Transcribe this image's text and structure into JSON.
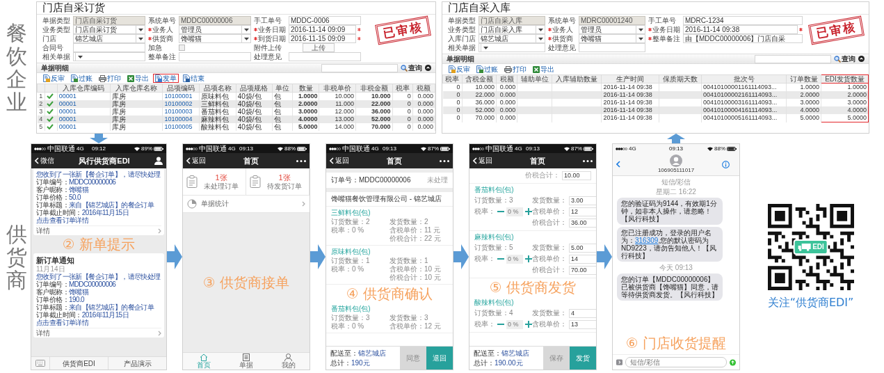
{
  "enterprise": {
    "side_label": "餐饮企业",
    "windows": [
      {
        "title": "门店自采订货",
        "stamp": "已审核",
        "form": [
          [
            {
              "label": "单据类型",
              "kind": "text",
              "value": "门店自采订货",
              "readonly": true
            },
            {
              "label": "系统单号",
              "kind": "text",
              "value": "MDDC00000006",
              "readonly": true
            },
            {
              "label": "手工单号",
              "kind": "text",
              "value": "MDDC-0006",
              "readonly": false
            }
          ],
          [
            {
              "label": "业务类型",
              "kind": "select",
              "value": "门店自采订货"
            },
            {
              "label": "业务人",
              "kind": "select",
              "value": "管理员",
              "required": true
            },
            {
              "label": "业务日期",
              "kind": "text",
              "value": "2016-11-14 09:09",
              "readonly": false,
              "required": true,
              "flagged": true
            }
          ],
          [
            {
              "label": "门店",
              "kind": "select",
              "value": "锦艺城店"
            },
            {
              "label": "供货商",
              "kind": "select",
              "value": "馋嘴猫",
              "required": true
            },
            {
              "label": "到货日期",
              "kind": "text",
              "value": "2016-11-15 09:09",
              "readonly": false,
              "required": true,
              "flagged": true
            }
          ],
          [
            {
              "label": "合同号",
              "kind": "text",
              "readonly": false
            },
            {
              "label": "加急",
              "kind": "checkbox",
              "checked": false
            },
            {
              "label": "附件上传",
              "kind": "button",
              "button": "上传"
            }
          ],
          [
            {
              "label": "相关单据",
              "kind": "select"
            },
            {
              "label": "整单备注",
              "kind": "text",
              "readonly": false
            },
            {
              "label": "处理意见",
              "kind": "text",
              "readonly": false
            }
          ]
        ],
        "section": {
          "title": "单据明细",
          "search_button": "查询"
        },
        "toolbar": [
          {
            "label": "反审",
            "kind": "review",
            "highlighted": false
          },
          {
            "label": "过账",
            "kind": "post",
            "highlighted": false
          },
          {
            "label": "打印",
            "kind": "print",
            "highlighted": false
          },
          {
            "label": "导出",
            "kind": "export",
            "highlighted": false
          },
          {
            "label": "发单",
            "kind": "send",
            "highlighted": true
          },
          {
            "label": "结束",
            "kind": "finish",
            "highlighted": false
          }
        ],
        "table": {
          "columns": [
            {
              "label": "入库仓库编码",
              "kind": "code"
            },
            {
              "label": "入库仓库名称",
              "kind": "text"
            },
            {
              "label": "品项编码",
              "kind": "code"
            },
            {
              "label": "品项名称",
              "kind": "text"
            },
            {
              "label": "品项规格",
              "kind": "text"
            },
            {
              "label": "单位",
              "kind": "text"
            },
            {
              "label": "数量",
              "kind": "number",
              "bold": true
            },
            {
              "label": "非税单价",
              "kind": "number"
            },
            {
              "label": "非税金额",
              "kind": "number",
              "bold": true
            },
            {
              "label": "税率",
              "kind": "number"
            },
            {
              "label": "税额",
              "kind": "number"
            }
          ],
          "rows": [
            {
              "no": "1",
              "approved": true,
              "cells": [
                "00001",
                "库房",
                "10100001",
                "原味料包",
                "40袋/包",
                "包",
                "1.0000",
                "10.000",
                "10.000",
                "0",
                "0.000"
              ]
            },
            {
              "no": "2",
              "approved": true,
              "cells": [
                "00001",
                "库房",
                "10100002",
                "三鲜料包",
                "40袋/包",
                "包",
                "2.0000",
                "11.000",
                "22.000",
                "0",
                "0.000"
              ]
            },
            {
              "no": "3",
              "approved": true,
              "cells": [
                "00001",
                "库房",
                "10100003",
                "番茄料包",
                "40袋/包",
                "包",
                "3.0000",
                "12.000",
                "36.000",
                "0",
                "0.000"
              ]
            },
            {
              "no": "4",
              "approved": true,
              "cells": [
                "00001",
                "库房",
                "10100004",
                "麻辣料包",
                "40袋/包",
                "包",
                "4.0000",
                "13.000",
                "52.000",
                "0",
                "0.000"
              ]
            },
            {
              "no": "5",
              "approved": true,
              "cells": [
                "00001",
                "库房",
                "10100005",
                "酸辣料包",
                "40袋/包",
                "包",
                "5.0000",
                "14.000",
                "70.000",
                "0",
                "0.000"
              ]
            }
          ]
        }
      },
      {
        "title": "门店自采入库",
        "stamp": "已审核",
        "form": [
          [
            {
              "label": "单据类型",
              "kind": "text",
              "value": "门店自采入库",
              "readonly": true
            },
            {
              "label": "系统单号",
              "kind": "text",
              "value": "MDRC00001240",
              "readonly": true
            },
            {
              "label": "手工单号",
              "kind": "text",
              "value": "MDRC-1234",
              "readonly": false
            }
          ],
          [
            {
              "label": "业务类型",
              "kind": "select",
              "value": "门店自采入库"
            },
            {
              "label": "业务人",
              "kind": "select",
              "value": "管理员",
              "required": true
            },
            {
              "label": "业务日期",
              "kind": "text",
              "value": "2016-11-14 09:38",
              "readonly": false,
              "required": true,
              "flagged": true
            }
          ],
          [
            {
              "label": "入库门店",
              "kind": "select",
              "value": "锦艺城店"
            },
            {
              "label": "供货商",
              "kind": "select",
              "value": "馋嘴猫",
              "required": true
            },
            {
              "label": "整单备注",
              "kind": "text",
              "value": "由【MDDC00000006】门店自采",
              "readonly": false,
              "required": true
            }
          ],
          [
            {
              "label": "相关单据",
              "kind": "select"
            },
            {
              "label": "处理意见",
              "kind": "text",
              "readonly": false
            }
          ]
        ],
        "section": {
          "title": "单据明细",
          "search_button": "查询"
        },
        "toolbar": [
          {
            "label": "反审",
            "kind": "review",
            "highlighted": false
          },
          {
            "label": "过账",
            "kind": "post",
            "highlighted": false
          },
          {
            "label": "打印",
            "kind": "print",
            "highlighted": false
          },
          {
            "label": "导出",
            "kind": "export",
            "highlighted": false
          }
        ],
        "table": {
          "columns": [
            {
              "label": "税率",
              "kind": "number",
              "highlighted": false
            },
            {
              "label": "含税金额",
              "kind": "number",
              "highlighted": false
            },
            {
              "label": "税额",
              "kind": "number",
              "highlighted": false
            },
            {
              "label": "辅助单位",
              "kind": "text",
              "highlighted": false
            },
            {
              "label": "入库辅助数量",
              "kind": "text",
              "highlighted": false
            },
            {
              "label": "生产时间",
              "kind": "date",
              "highlighted": false
            },
            {
              "label": "保质期天数",
              "kind": "text",
              "highlighted": false
            },
            {
              "label": "批次号",
              "kind": "date",
              "highlighted": false
            },
            {
              "label": "订单数量",
              "kind": "number",
              "highlighted": false
            },
            {
              "label": "EDI发货数量",
              "kind": "number",
              "highlighted": true
            }
          ],
          "rows": [
            {
              "cells": [
                "0",
                "10.000",
                "0.000",
                null,
                null,
                "2016-11-14 09:38",
                null,
                "00410100001161114093...",
                "1.0000",
                "1.0000"
              ]
            },
            {
              "cells": [
                "0",
                "22.000",
                "0.000",
                null,
                null,
                "2016-11-14 09:38",
                null,
                "00410100002161114093...",
                "2.0000",
                "2.0000"
              ]
            },
            {
              "cells": [
                "0",
                "36.000",
                "0.000",
                null,
                null,
                "2016-11-14 09:38",
                null,
                "00410100003161114093...",
                "3.0000",
                "3.0000"
              ]
            },
            {
              "cells": [
                "0",
                "52.000",
                "0.000",
                null,
                null,
                "2016-11-14 09:38",
                null,
                "00410100004161114093...",
                "4.0000",
                "4.0000"
              ]
            },
            {
              "cells": [
                "0",
                "70.000",
                "0.000",
                null,
                null,
                "2016-11-14 09:38",
                null,
                "00410100005161114093...",
                "5.0000",
                "5.0000"
              ]
            }
          ]
        }
      }
    ]
  },
  "supplier": {
    "side_label": "供货商",
    "phones": [
      {
        "kind": "chat",
        "status": {
          "carrier": "中国联通",
          "network": "4G",
          "time": "09:12",
          "battery": "89%"
        },
        "nav": {
          "back": "微信",
          "title": "风行供货商EDI"
        },
        "caption": "② 新单提示",
        "cards": [
          {
            "lines": [
              {
                "kind": "notice",
                "text": "您收到了一张新【餐企订单】，请尽快处理"
              },
              {
                "kind": "field",
                "label": "订单编号：",
                "value": "MDDC00000006"
              },
              {
                "kind": "field",
                "label": "客户昵称：",
                "value": "馋嘴猫"
              },
              {
                "kind": "field",
                "label": "订单价格：",
                "value": "50.0"
              },
              {
                "kind": "field",
                "label": "订单标题：",
                "value": "来自【锦艺城店】的餐企订单"
              },
              {
                "kind": "field",
                "label": "订单截止时间：",
                "value": "2016年11月15日"
              },
              {
                "kind": "link",
                "text": "点击查看订单详情"
              }
            ],
            "footer": "详情"
          },
          {
            "title": "新订单通知",
            "date": "11月14日",
            "lines": [
              {
                "kind": "notice",
                "text": "您收到了一张新【餐企订单】，请尽快处理"
              },
              {
                "kind": "field",
                "label": "订单编号：",
                "value": "MDDC00000006"
              },
              {
                "kind": "field",
                "label": "客户昵称：",
                "value": "馋嘴猫"
              },
              {
                "kind": "field",
                "label": "订单价格：",
                "value": "190.0"
              },
              {
                "kind": "field",
                "label": "订单标题：",
                "value": "来自【锦艺城店】的餐企订单"
              },
              {
                "kind": "field",
                "label": "订单截止时间：",
                "value": "2016年11月15日"
              },
              {
                "kind": "link",
                "text": "点击查看订单详情"
              }
            ],
            "footer": "详情"
          }
        ],
        "menu": [
          "供货商EDI",
          "产品演示"
        ]
      },
      {
        "kind": "home",
        "status": {
          "carrier": "中国联通",
          "network": "4G",
          "time": "09:13",
          "battery": "88%"
        },
        "nav": {
          "back": "返回",
          "title": "首页"
        },
        "caption": "③ 供货商接单",
        "tiles": [
          {
            "count": "1张",
            "label": "未处理订单"
          },
          {
            "count": "1张",
            "label": "待发货订单"
          }
        ],
        "row": "单据统计",
        "tabs": [
          {
            "label": "首页",
            "selected": true
          },
          {
            "label": "单据",
            "selected": false
          },
          {
            "label": "我的",
            "selected": false
          }
        ]
      },
      {
        "kind": "order",
        "status": {
          "carrier": "中国联通",
          "network": "4G",
          "time": "09:13",
          "battery": "87%"
        },
        "nav": {
          "back": "返回",
          "title": "首页"
        },
        "caption": "④ 供货商确认",
        "order_no": "订单号：MDDC00000006",
        "order_status": "未处理",
        "company": "馋嘴猫餐饮管理有限公司 - 锦艺城店",
        "items": [
          {
            "name": "三鲜料包(包)",
            "left": [
              "订货数量：2",
              "税率：0 %"
            ],
            "right": [
              "发货数量：2",
              "含税单价：11 元",
              "价税合计：22 元"
            ]
          },
          {
            "name": "原味料包(包)",
            "left": [
              "订货数量：1",
              "税率：0 %"
            ],
            "right": [
              "发货数量：1",
              "含税单价：10 元",
              "价税合计：10 元"
            ]
          },
          {
            "name": "番茄料包(包)",
            "left": [
              "订货数量：3",
              "税率：0 %"
            ],
            "right": [
              "发货数量：3",
              "含税单价：12 元"
            ]
          }
        ],
        "footer": {
          "dest_label": "配送至：",
          "dest": "锦艺城店",
          "total_label": "总计：",
          "total": "190元",
          "buttons": [
            {
              "label": "同意",
              "kind": "secondary"
            },
            {
              "label": "退回",
              "kind": "primary"
            }
          ]
        }
      },
      {
        "kind": "ship",
        "status": {
          "carrier": "中国联通",
          "network": "4G",
          "time": "09:13",
          "battery": "87%"
        },
        "nav": {
          "back": "返回",
          "title": "首页"
        },
        "caption": "⑤ 供货商发货",
        "top_field": {
          "label": "价税合计：",
          "value": "10.00"
        },
        "items": [
          {
            "name": "番茄料包(包)",
            "ordered": "订货数量：3",
            "tax_label": "税率：",
            "tax": "0 %",
            "fields": [
              {
                "label": "发货数量：",
                "value": "3.00"
              },
              {
                "label": "含税单价：",
                "value": "12"
              },
              {
                "label": "价税合计：",
                "value": "36.00"
              }
            ]
          },
          {
            "name": "麻辣料包(包)",
            "ordered": "订货数量：5",
            "tax_label": "税率：",
            "tax": "0 %",
            "fields": [
              {
                "label": "发货数量：",
                "value": "5.00"
              },
              {
                "label": "含税单价：",
                "value": "14"
              },
              {
                "label": "价税合计：",
                "value": "70.00"
              }
            ]
          },
          {
            "name": "酸辣料包(包)",
            "ordered": "订货数量：4",
            "tax_label": "税率：",
            "tax": "0 %",
            "fields": [
              {
                "label": "发货数量：",
                "value": "4"
              },
              {
                "label": "含税单价：",
                "value": "13"
              }
            ]
          }
        ],
        "footer": {
          "dest_label": "配送至：",
          "dest": "锦艺城店",
          "total_label": "总计：",
          "total": "190.00元",
          "buttons": [
            {
              "label": "保存",
              "kind": "secondary"
            },
            {
              "label": "发货",
              "kind": "primary"
            }
          ]
        }
      },
      {
        "kind": "sms",
        "status": {
          "network": "4G",
          "time": "09:13",
          "battery": "88%"
        },
        "contact": "106905111017",
        "caption": "⑥ 门店收货提醒",
        "placeholder": "短信/彩信",
        "thread": [
          {
            "kind": "time",
            "text": "短信/彩信"
          },
          {
            "kind": "time",
            "text": "星期二 16:22"
          },
          {
            "kind": "bubble",
            "parts": [
              {
                "text": "您的验证码为9144，有效期1分钟，如非本人操作，请忽略！【风行科技】"
              }
            ]
          },
          {
            "kind": "bubble",
            "parts": [
              {
                "text": "您已注册成功，登录的用户名为："
              },
              {
                "text": "316309",
                "link": true
              },
              {
                "text": ",您的默认密码为ND9223，请勿告知他人！【风行科技】"
              }
            ]
          },
          {
            "kind": "time",
            "text": "今天 09:13"
          },
          {
            "kind": "bubble",
            "parts": [
              {
                "text": "您的订单【MDDC00000006】已被供货商【馋嘴猫】同意，请等待供货商发货。【风行科技】"
              }
            ]
          }
        ]
      }
    ],
    "qr": {
      "badge": "EDI",
      "caption": "关注“供货商EDI”"
    }
  }
}
